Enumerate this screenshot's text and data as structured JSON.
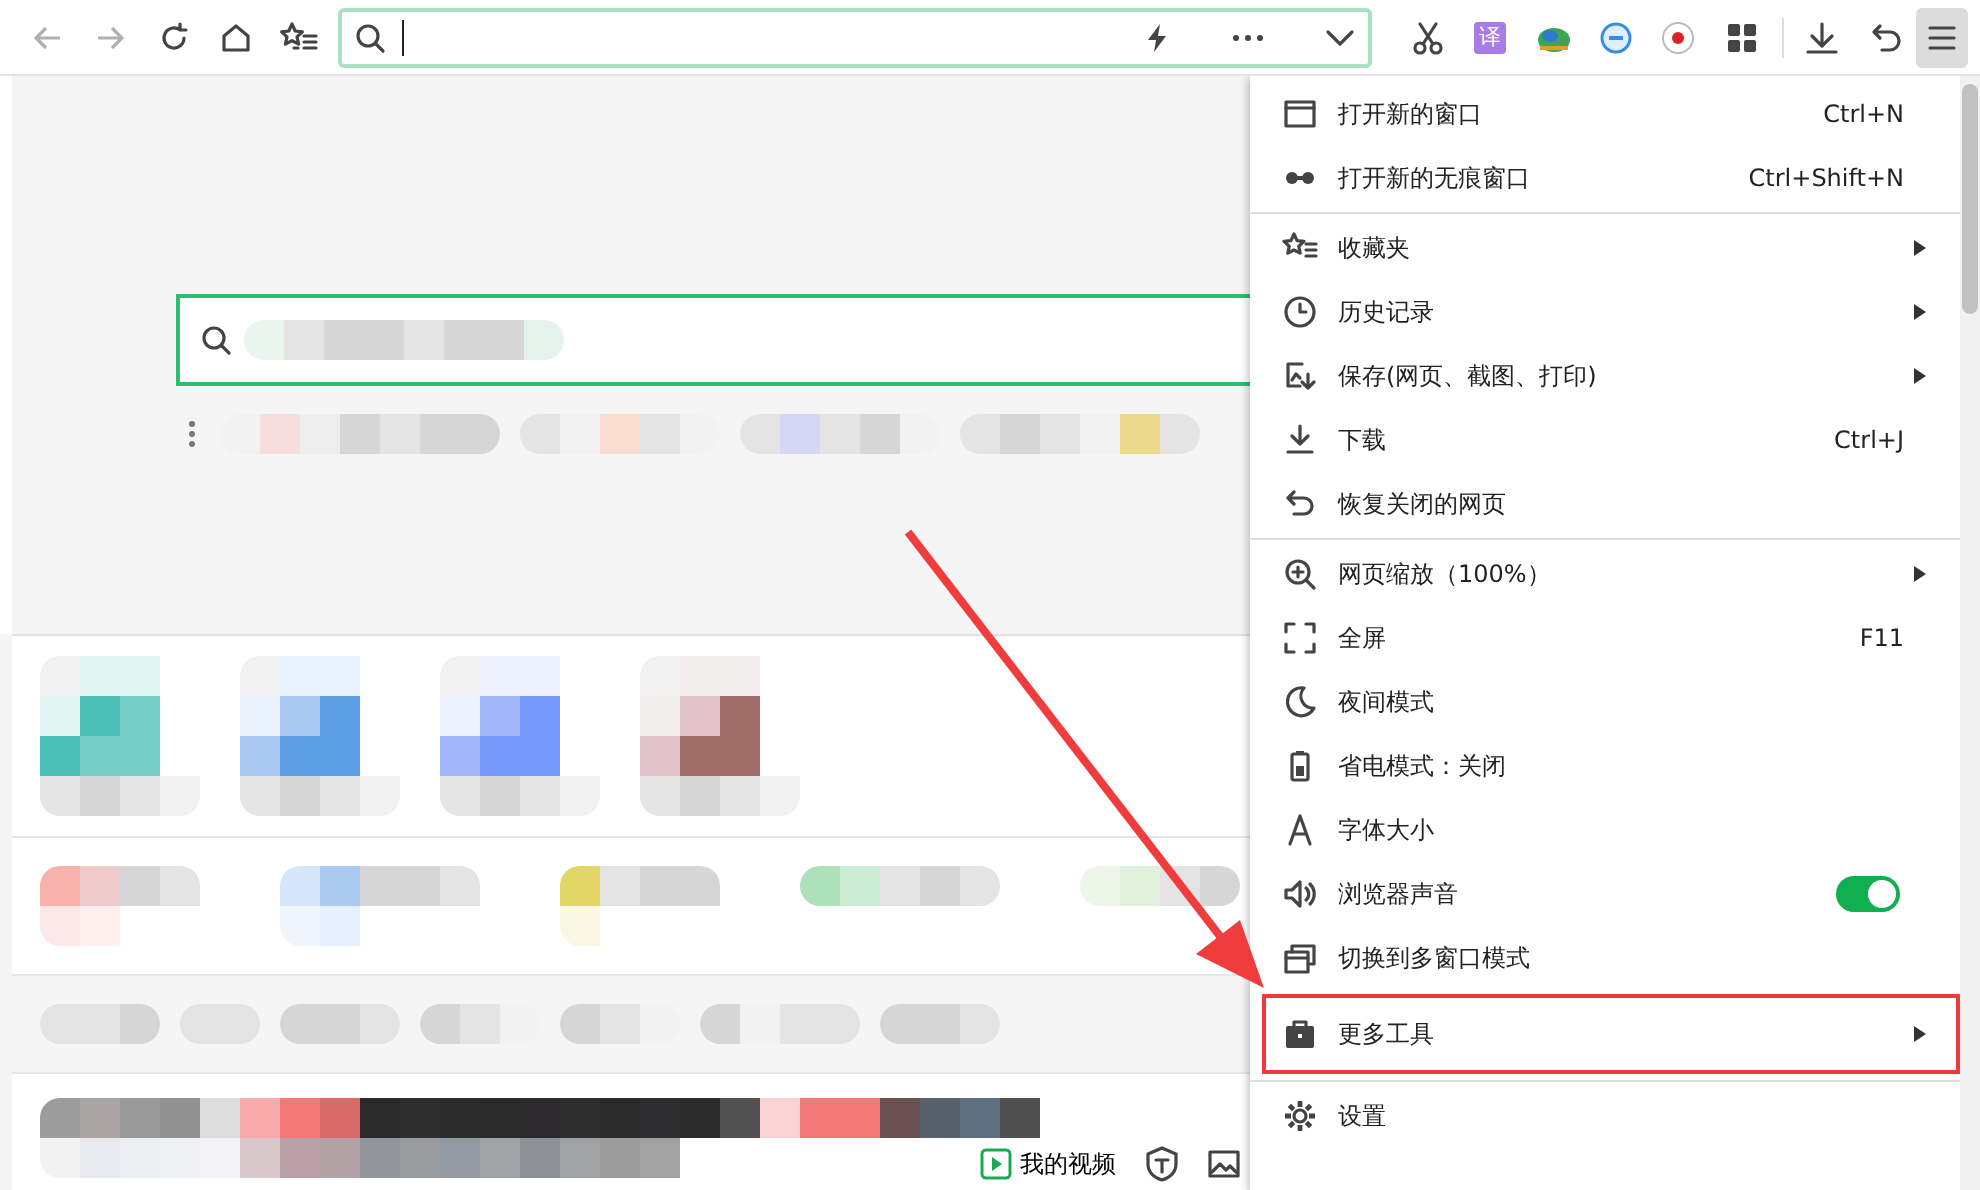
{
  "toolbar": {
    "back_disabled": true,
    "forward_disabled": true,
    "translate_label": "译",
    "menu_open": true
  },
  "menu": {
    "groups": [
      {
        "items": [
          {
            "label": "打开新的窗口",
            "kind": "shortcut",
            "shortcut": "Ctrl+N",
            "highlighted": false
          },
          {
            "label": "打开新的无痕窗口",
            "kind": "shortcut",
            "shortcut": "Ctrl+Shift+N",
            "highlighted": false
          }
        ]
      },
      {
        "items": [
          {
            "label": "收藏夹",
            "kind": "submenu",
            "highlighted": false
          },
          {
            "label": "历史记录",
            "kind": "submenu",
            "highlighted": false
          },
          {
            "label": "保存(网页、截图、打印)",
            "kind": "submenu",
            "highlighted": false
          },
          {
            "label": "下载",
            "kind": "shortcut",
            "shortcut": "Ctrl+J",
            "highlighted": false
          },
          {
            "label": "恢复关闭的网页",
            "kind": "plain",
            "highlighted": false
          }
        ]
      },
      {
        "items": [
          {
            "label": "网页缩放（100%）",
            "kind": "submenu",
            "highlighted": false
          },
          {
            "label": "全屏",
            "kind": "shortcut",
            "shortcut": "F11",
            "highlighted": false
          },
          {
            "label": "夜间模式",
            "kind": "plain",
            "highlighted": false
          },
          {
            "label": "省电模式：关闭",
            "kind": "plain",
            "highlighted": false
          },
          {
            "label": "字体大小",
            "kind": "plain",
            "highlighted": false
          },
          {
            "label": "浏览器声音",
            "kind": "toggle",
            "on": true,
            "highlighted": false
          },
          {
            "label": "切换到多窗口模式",
            "kind": "plain",
            "highlighted": false
          },
          {
            "label": "更多工具",
            "kind": "submenu",
            "highlighted": true
          }
        ]
      },
      {
        "items": [
          {
            "label": "设置",
            "kind": "plain",
            "highlighted": false
          }
        ]
      }
    ]
  },
  "status_bar": {
    "video_label": "我的视频"
  }
}
